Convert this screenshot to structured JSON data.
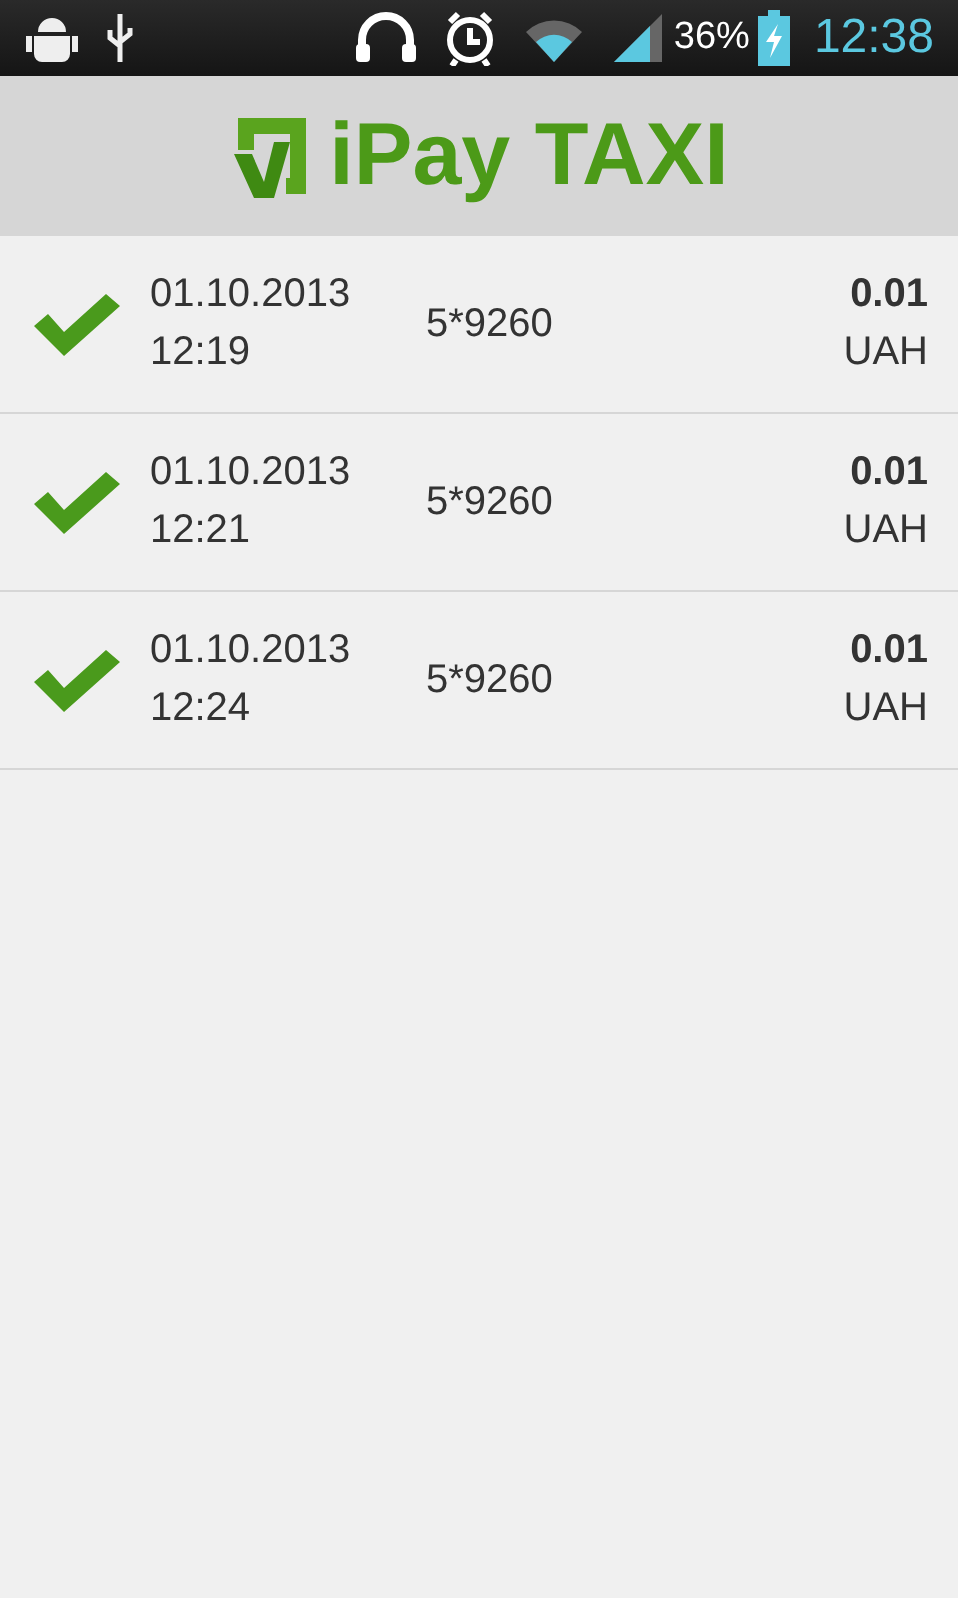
{
  "status_bar": {
    "battery": "36%",
    "time": "12:38"
  },
  "header": {
    "title": "iPay TAXI"
  },
  "transactions": [
    {
      "completed": true,
      "date": "01.10.2013",
      "time": "12:19",
      "card": "5*9260",
      "amount": "0.01",
      "currency": "UAH"
    },
    {
      "completed": true,
      "date": "01.10.2013",
      "time": "12:21",
      "card": "5*9260",
      "amount": "0.01",
      "currency": "UAH"
    },
    {
      "completed": true,
      "date": "01.10.2013",
      "time": "12:24",
      "card": "5*9260",
      "amount": "0.01",
      "currency": "UAH"
    }
  ]
}
